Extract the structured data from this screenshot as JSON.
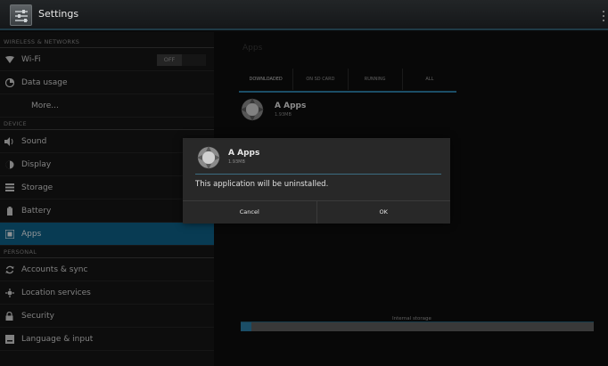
{
  "action_bar": {
    "title": "Settings",
    "icon": "settings-icon",
    "overflow_icon": "overflow-menu-icon"
  },
  "sidebar": {
    "sections": [
      {
        "label": "WIRELESS & NETWORKS"
      },
      {
        "label": "DEVICE"
      },
      {
        "label": "PERSONAL"
      }
    ],
    "items": [
      {
        "label": "Wi-Fi",
        "icon": "wifi-icon",
        "toggle": "OFF"
      },
      {
        "label": "Data usage",
        "icon": "data-usage-icon"
      },
      {
        "label": "More..."
      },
      {
        "label": "Sound",
        "icon": "sound-icon"
      },
      {
        "label": "Display",
        "icon": "display-icon"
      },
      {
        "label": "Storage",
        "icon": "storage-icon"
      },
      {
        "label": "Battery",
        "icon": "battery-icon"
      },
      {
        "label": "Apps",
        "icon": "apps-icon",
        "selected": true
      },
      {
        "label": "Accounts & sync",
        "icon": "sync-icon"
      },
      {
        "label": "Location services",
        "icon": "location-icon"
      },
      {
        "label": "Security",
        "icon": "lock-icon"
      },
      {
        "label": "Language & input",
        "icon": "keyboard-icon"
      }
    ]
  },
  "main": {
    "header": "Apps",
    "tabs": [
      "DOWNLOADED",
      "ON SD CARD",
      "RUNNING",
      "ALL"
    ],
    "active_tab": "DOWNLOADED",
    "apps": [
      {
        "name": "A Apps",
        "size": "1.93MB"
      }
    ],
    "storage": {
      "label": "Internal storage",
      "used_fraction": 0.03
    }
  },
  "dialog": {
    "app_name": "A Apps",
    "app_size": "1.93MB",
    "message": "This application will be uninstalled.",
    "cancel_label": "Cancel",
    "ok_label": "OK"
  },
  "colors": {
    "accent": "#0e5f87",
    "highlight_line": "#2d7fa6",
    "background": "#0a0a0a"
  }
}
